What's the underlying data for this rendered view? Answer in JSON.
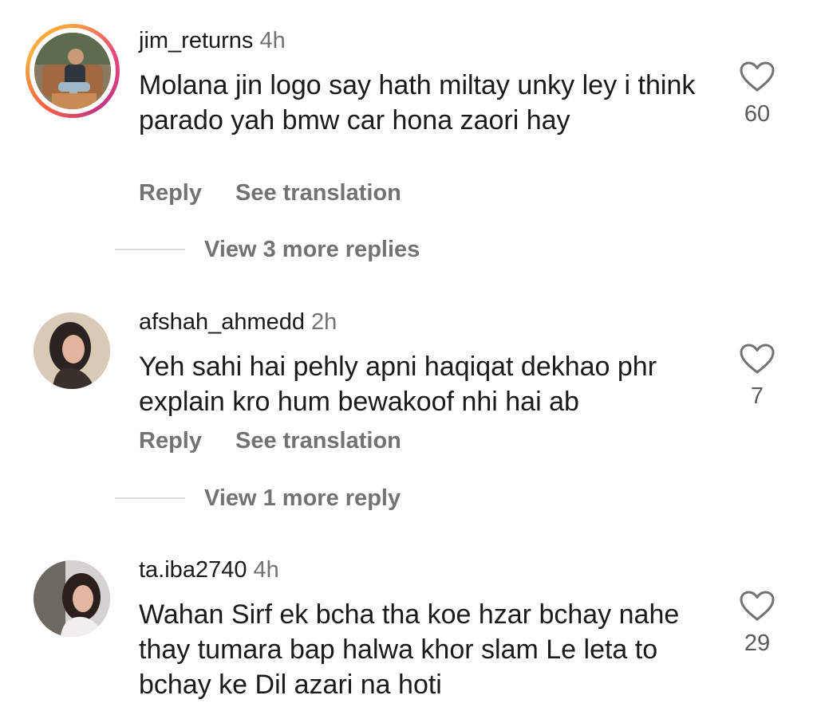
{
  "comments": [
    {
      "username": "jim_returns",
      "time": "4h",
      "text": "Molana jin logo say hath miltay unky ley i think parado yah bmw car hona zaori hay",
      "reply_label": "Reply",
      "translate_label": "See translation",
      "likes": "60",
      "more_replies": "View 3 more replies",
      "avatar_icon": "user-photo-with-story-ring"
    },
    {
      "username": "afshah_ahmedd",
      "time": "2h",
      "text": "Yeh sahi hai pehly apni haqiqat dekhao phr explain kro hum bewakoof nhi hai ab",
      "reply_label": "Reply",
      "translate_label": "See translation",
      "likes": "7",
      "more_replies": "View 1 more reply",
      "avatar_icon": "user-photo"
    },
    {
      "username": "ta.iba2740",
      "time": "4h",
      "text": "Wahan Sirf ek bcha tha koe hzar bchay nahe thay tumara bap halwa khor slam Le leta to bchay ke Dil azari na hoti",
      "likes": "29",
      "avatar_icon": "user-photo"
    }
  ],
  "colors": {
    "text": "#1a1a1a",
    "secondary": "#737373",
    "divider": "#d9d9d9",
    "story_ring_start": "#f9a23b",
    "story_ring_end": "#c13584"
  }
}
